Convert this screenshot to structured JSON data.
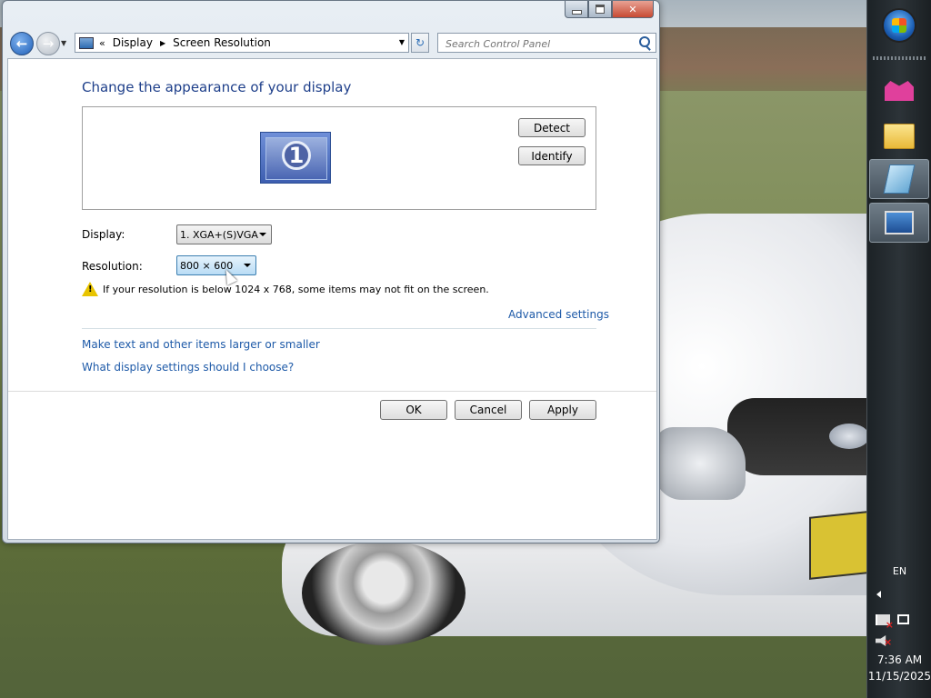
{
  "navigation": {
    "address_parts": [
      "Display",
      "Screen Resolution"
    ],
    "search_placeholder": "Search Control Panel"
  },
  "content": {
    "title": "Change the appearance of your display",
    "monitor_number": "1",
    "detect_label": "Detect",
    "identify_label": "Identify",
    "display_label": "Display:",
    "display_value": "1. XGA+(S)VGA",
    "resolution_label": "Resolution:",
    "resolution_value": "800 × 600",
    "warning_text": "If your resolution is below 1024 x 768, some items may not fit on the screen.",
    "advanced_link": "Advanced settings",
    "links": [
      "Make text and other items larger or smaller",
      "What display settings should I choose?"
    ],
    "ok_label": "OK",
    "cancel_label": "Cancel",
    "apply_label": "Apply"
  },
  "taskbar": {
    "language": "EN",
    "time": "7:36 AM",
    "date": "11/15/2025"
  },
  "colors": {
    "link": "#1e5aa8",
    "title": "#1e3f8a",
    "close_button": "#c74a33",
    "taskbar": "#2c3338"
  },
  "icons": [
    "back-arrow-icon",
    "forward-arrow-icon",
    "refresh-icon",
    "search-icon",
    "warning-icon",
    "start-orb-icon",
    "folder-icon",
    "display-icon"
  ]
}
